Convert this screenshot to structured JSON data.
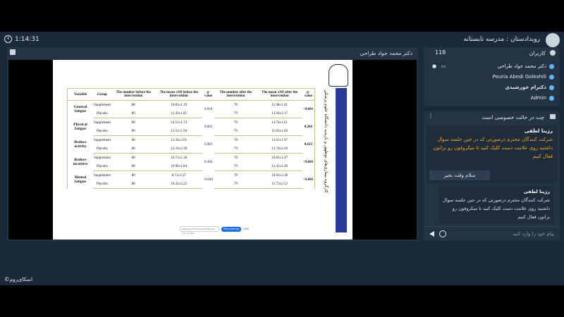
{
  "header": {
    "timer": "1:14:31",
    "room_title": "رویدادستان : مدرسه تابستانه"
  },
  "toolbar": {
    "buttons": [
      "speaker-icon",
      "mic-icon",
      "camera-off-icon",
      "screen-icon",
      "pen-icon",
      "lock-icon",
      "hand-icon"
    ]
  },
  "presentation": {
    "presenter": "دکتر محمد جواد طراحی",
    "slide_side_text": "کارگروه بیماری‌های نوظهور و بازپدید دانشگاه علوم پزشکی",
    "table": {
      "headers": [
        "Variable",
        "Group",
        "The number before the intervention",
        "The mean ±SD before the intervention",
        "p-value",
        "The number after the intervention",
        "The mean ±SD after the intervention",
        "p-value"
      ],
      "rows": [
        {
          "variable": "General fatigue",
          "g1": "Supplement",
          "n1": "80",
          "m1": "10.83±1.19",
          "p1": "0.016",
          "na1": "78",
          "ma1": "11.98±1.41",
          "p2": "<0.001",
          "g2": "Placebo",
          "n2": "80",
          "m2": "11.43±1.85",
          "na2": "79",
          "ma2": "13.94±2.17"
        },
        {
          "variable": "Physical fatigue",
          "g1": "Supplement",
          "n1": "80",
          "m1": "14.51±1.74",
          "p1": "0.001",
          "na1": "78",
          "ma1": "14.74±1.61",
          "p2": "0.266",
          "g2": "Placebo",
          "n2": "80",
          "m2": "13.51±1.94",
          "na2": "79",
          "ma2": "15.03±1.69"
        },
        {
          "variable": "Reduce activity",
          "g1": "Supplement",
          "n1": "80",
          "m1": "13.36±2.01",
          "p1": "0.001",
          "na1": "78",
          "ma1": "13.61±1.97",
          "p2": "0.613",
          "g2": "Placebo",
          "n2": "80",
          "m2": "12.16±2.30",
          "na2": "79",
          "ma2": "13.74±2.20"
        },
        {
          "variable": "Reduce incentive",
          "g1": "Supplement",
          "n1": "80",
          "m1": "10.73±1.38",
          "p1": "0.384",
          "na1": "78",
          "ma1": "10.83±1.47",
          "p2": "<0.001",
          "g2": "Placebo",
          "n2": "80",
          "m2": "10.96±1.84",
          "na2": "79",
          "ma2": "12.41±2.30"
        },
        {
          "variable": "Mental fatigue",
          "g1": "Supplement",
          "n1": "80",
          "m1": "8.71±2.27",
          "p1": "<0.001",
          "na1": "78",
          "ma1": "10.83±2.28",
          "p2": "<0.001",
          "g2": "Placebo",
          "n2": "80",
          "m2": "10.32±2.22",
          "na2": "79",
          "ma2": "12.73±2.52"
        }
      ]
    },
    "share_bar": {
      "message": "www.skyroom.online is sharing your screen.",
      "stop_label": "Stop sharing",
      "hide_label": "Hide"
    }
  },
  "users": {
    "title": "کاربران",
    "count": "118",
    "list": [
      "دکتر محمد جواد طراحی",
      "Pouria Abedi Golexhili",
      "دکترام خورشیدی",
      "Admin"
    ]
  },
  "chat": {
    "title": "چت در حالت خصوصی است",
    "messages": [
      {
        "name": "رژینا لطفی",
        "body": "شرکت کنندگان محترم درصورتی که در حین جلسه سوال داشتید روی علامت دست کلیک کنید تا میکروفون رو براتون فعال کنیم",
        "reply": "سلام وقت بخیر"
      },
      {
        "name": "رژینا لطفی",
        "body": "شرکت کنندگان محترم درصورتی که در حین جلسه سوال داشتید روی علامت دست کلیک کنید تا میکروفون رو براتون فعال کنیم"
      }
    ],
    "input_placeholder": "پیام خود را وارد کنید"
  },
  "brand": "اسکای‌روم"
}
